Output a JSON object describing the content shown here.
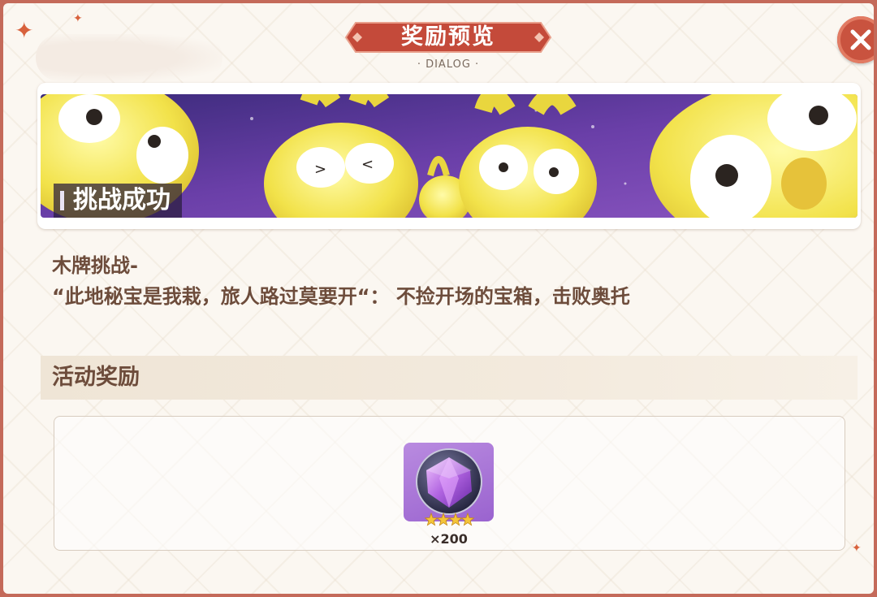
{
  "header": {
    "title": "奖励预览",
    "subtitle": "· DIALOG ·"
  },
  "hero": {
    "label": "挑战成功"
  },
  "description": {
    "line1": "木牌挑战-",
    "line2": "“此地秘宝是我栽，旅人路过莫要开“： 不捡开场的宝箱，击败奥托"
  },
  "rewards_section": {
    "title": "活动奖励",
    "items": [
      {
        "icon": "purple-gem-icon",
        "rarity_stars": 4,
        "quantity": "×200"
      }
    ]
  },
  "colors": {
    "frame_border": "#c46a5a",
    "banner_red": "#c44a3a",
    "text_brown": "#6d4c3b",
    "item_purple": "#9a63cf"
  }
}
